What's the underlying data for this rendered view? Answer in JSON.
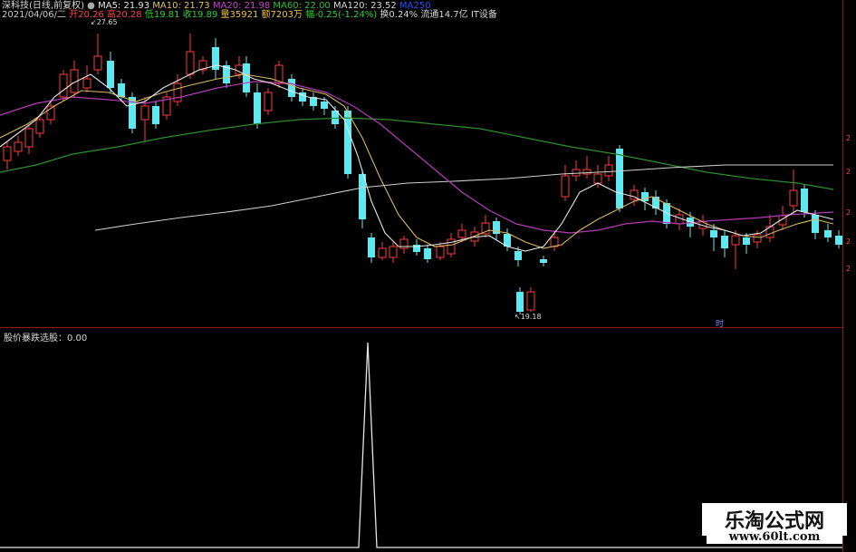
{
  "header": {
    "symbol": "深科技(日线,前复权)",
    "ma5": "MA5: 21.93",
    "ma10": "MA10: 21.73",
    "ma20": "MA20: 21.98",
    "ma60": "MA60: 22.00",
    "ma120": "MA120: 23.52",
    "ma250": "MA250",
    "date": "2021/04/06/二",
    "open": "开20.26",
    "high": "高20.28",
    "low": "低19.81",
    "close": "收19.89",
    "volume": "量35921",
    "amount": "额7203万",
    "change": "幅-0.25(-1.24%)",
    "turnover": "换0.24%",
    "float": "流通14.7亿",
    "sector": "IT设备"
  },
  "annotations": {
    "high_label": "27.65",
    "low_label": "19.18"
  },
  "indicator": {
    "label": "股价暴跌选股：0.00"
  },
  "right_axis": {
    "ticks": [
      "2",
      "2",
      "2",
      "2",
      "2"
    ]
  },
  "time_label": "时",
  "watermark": {
    "line1": "乐淘公式网",
    "line2": "www.60lt.com"
  },
  "colors": {
    "up": "#ff3a3a",
    "down": "#5fe8f0",
    "ma5": "#e6e6e6",
    "ma10": "#e0c060",
    "ma20": "#c040c0",
    "ma60": "#30a030",
    "ma120": "#d8d8d8",
    "ma250": "#3050ff"
  }
}
